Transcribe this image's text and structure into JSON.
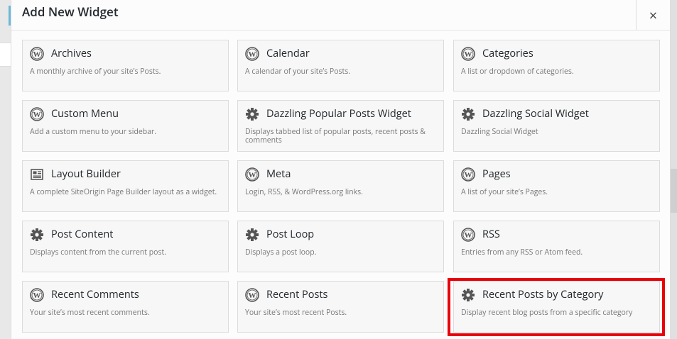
{
  "modal": {
    "title": "Add New Widget",
    "close_label": "×"
  },
  "widgets": [
    {
      "title": "Archives",
      "desc": "A monthly archive of your site’s Posts.",
      "icon": "wordpress-icon"
    },
    {
      "title": "Calendar",
      "desc": "A calendar of your site’s Posts.",
      "icon": "wordpress-icon"
    },
    {
      "title": "Categories",
      "desc": "A list or dropdown of categories.",
      "icon": "wordpress-icon"
    },
    {
      "title": "Custom Menu",
      "desc": "Add a custom menu to your sidebar.",
      "icon": "wordpress-icon"
    },
    {
      "title": "Dazzling Popular Posts Widget",
      "desc": "Displays tabbed list of popular posts, recent posts & comments",
      "icon": "gear-icon"
    },
    {
      "title": "Dazzling Social Widget",
      "desc": "Dazzling Social Widget",
      "icon": "gear-icon"
    },
    {
      "title": "Layout Builder",
      "desc": "A complete SiteOrigin Page Builder layout as a widget.",
      "icon": "layout-builder-icon"
    },
    {
      "title": "Meta",
      "desc": "Login, RSS, & WordPress.org links.",
      "icon": "wordpress-icon"
    },
    {
      "title": "Pages",
      "desc": "A list of your site’s Pages.",
      "icon": "wordpress-icon"
    },
    {
      "title": "Post Content",
      "desc": "Displays content from the current post.",
      "icon": "gear-icon"
    },
    {
      "title": "Post Loop",
      "desc": "Displays a post loop.",
      "icon": "gear-icon"
    },
    {
      "title": "RSS",
      "desc": "Entries from any RSS or Atom feed.",
      "icon": "wordpress-icon"
    },
    {
      "title": "Recent Comments",
      "desc": "Your site’s most recent comments.",
      "icon": "wordpress-icon"
    },
    {
      "title": "Recent Posts",
      "desc": "Your site’s most recent Posts.",
      "icon": "wordpress-icon"
    },
    {
      "title": "Recent Posts by Category",
      "desc": "Display recent blog posts from a specific category",
      "icon": "gear-icon"
    }
  ],
  "highlight_color": "#e8000b"
}
